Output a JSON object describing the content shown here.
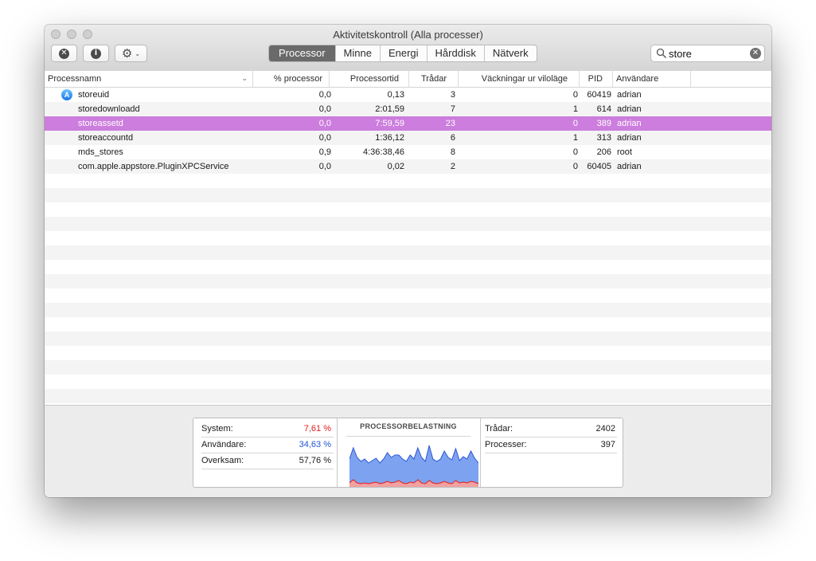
{
  "window": {
    "title": "Aktivitetskontroll (Alla processer)"
  },
  "tabs": [
    {
      "label": "Processor",
      "active": true
    },
    {
      "label": "Minne",
      "active": false
    },
    {
      "label": "Energi",
      "active": false
    },
    {
      "label": "Hårddisk",
      "active": false
    },
    {
      "label": "Nätverk",
      "active": false
    }
  ],
  "search": {
    "value": "store"
  },
  "columns": [
    "Processnamn",
    "% processor",
    "Processortid",
    "Trådar",
    "Väckningar ur viloläge",
    "PID",
    "Användare"
  ],
  "processes": [
    {
      "name": "storeuid",
      "cpu": "0,0",
      "time": "0,13",
      "threads": "3",
      "wakeups": "0",
      "pid": "60419",
      "user": "adrian",
      "selected": false,
      "icon": "app-store-icon"
    },
    {
      "name": "storedownloadd",
      "cpu": "0,0",
      "time": "2:01,59",
      "threads": "7",
      "wakeups": "1",
      "pid": "614",
      "user": "adrian",
      "selected": false
    },
    {
      "name": "storeassetd",
      "cpu": "0,0",
      "time": "7:59,59",
      "threads": "23",
      "wakeups": "0",
      "pid": "389",
      "user": "adrian",
      "selected": true
    },
    {
      "name": "storeaccountd",
      "cpu": "0,0",
      "time": "1:36,12",
      "threads": "6",
      "wakeups": "1",
      "pid": "313",
      "user": "adrian",
      "selected": false
    },
    {
      "name": "mds_stores",
      "cpu": "0,9",
      "time": "4:36:38,46",
      "threads": "8",
      "wakeups": "0",
      "pid": "206",
      "user": "root",
      "selected": false
    },
    {
      "name": "com.apple.appstore.PluginXPCService",
      "cpu": "0,0",
      "time": "0,02",
      "threads": "2",
      "wakeups": "0",
      "pid": "60405",
      "user": "adrian",
      "selected": false
    }
  ],
  "stats": {
    "system_label": "System:",
    "system_value": "7,61 %",
    "user_label": "Användare:",
    "user_value": "34,63 %",
    "idle_label": "Overksam:",
    "idle_value": "57,76 %",
    "graph_title": "PROCESSORBELASTNING",
    "threads_label": "Trådar:",
    "threads_value": "2402",
    "processes_label": "Processer:",
    "processes_value": "397"
  },
  "colors": {
    "selection": "#cc7ddd",
    "system": "#e02020",
    "user": "#2255d6",
    "graph_user": "#7da2ef",
    "graph_system": "#f2a0a0"
  },
  "cpu_history": {
    "user": [
      30,
      40,
      32,
      28,
      30,
      26,
      28,
      30,
      26,
      30,
      36,
      32,
      34,
      32,
      30,
      28,
      34,
      30,
      40,
      32,
      28,
      44,
      30,
      28,
      30,
      38,
      32,
      30,
      40,
      28,
      32,
      30,
      38,
      30,
      26
    ],
    "system": [
      5,
      9,
      5,
      4,
      5,
      4,
      5,
      6,
      4,
      5,
      7,
      5,
      6,
      8,
      5,
      4,
      6,
      5,
      9,
      5,
      4,
      8,
      5,
      4,
      5,
      7,
      5,
      4,
      8,
      5,
      6,
      5,
      7,
      6,
      4
    ]
  }
}
